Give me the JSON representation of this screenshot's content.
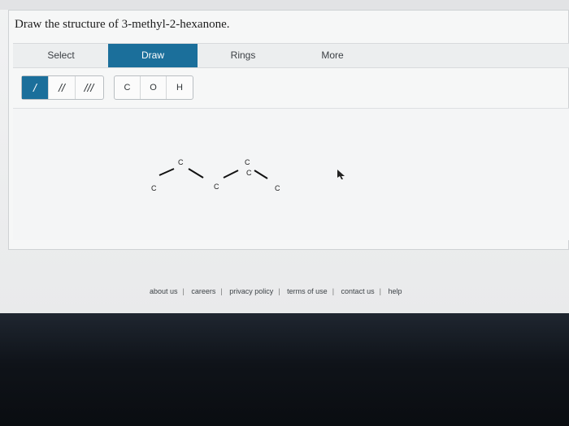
{
  "question": {
    "text": "Draw the structure of 3-methyl-2-hexanone."
  },
  "tabs": [
    {
      "label": "Select"
    },
    {
      "label": "Draw",
      "active": true
    },
    {
      "label": "Rings"
    },
    {
      "label": "More"
    }
  ],
  "tools": {
    "bonds": [
      {
        "label": "/",
        "name": "single-bond",
        "active": true
      },
      {
        "label": "//",
        "name": "double-bond"
      },
      {
        "label": "///",
        "name": "triple-bond"
      }
    ],
    "atoms": [
      {
        "label": "C"
      },
      {
        "label": "O"
      },
      {
        "label": "H"
      }
    ]
  },
  "molecule": {
    "atoms": [
      "C",
      "C",
      "C",
      "C",
      "C",
      "C"
    ]
  },
  "footer": {
    "links": [
      "about us",
      "careers",
      "privacy policy",
      "terms of use",
      "contact us",
      "help"
    ]
  },
  "colors": {
    "accent": "#1b6f9b",
    "bezel": "#0f1319"
  }
}
